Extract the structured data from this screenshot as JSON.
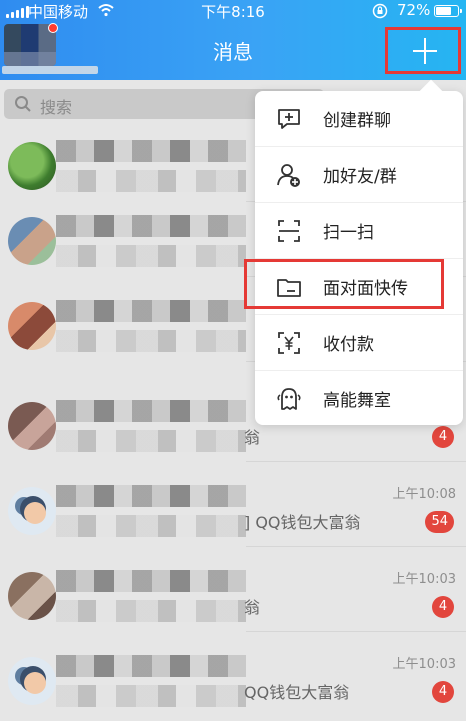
{
  "status_bar": {
    "carrier": "中国移动",
    "time": "下午8:16",
    "battery": "72%"
  },
  "header": {
    "title": "消息"
  },
  "search": {
    "placeholder": "搜索"
  },
  "menu": {
    "items": [
      {
        "label": "创建群聊",
        "icon": "group-chat-icon"
      },
      {
        "label": "加好友/群",
        "icon": "add-friend-icon"
      },
      {
        "label": "扫一扫",
        "icon": "scan-icon"
      },
      {
        "label": "面对面快传",
        "icon": "folder-icon"
      },
      {
        "label": "收付款",
        "icon": "payment-icon"
      },
      {
        "label": "高能舞室",
        "icon": "ghost-icon"
      }
    ]
  },
  "conversations": [
    {
      "time": "",
      "preview": "",
      "badge": ""
    },
    {
      "time": "",
      "preview": "",
      "badge": ""
    },
    {
      "time": "",
      "preview": "",
      "badge": ""
    },
    {
      "time": "",
      "preview": "翁",
      "badge": "4"
    },
    {
      "time": "上午10:08",
      "preview": "] QQ钱包大富翁",
      "badge": "54"
    },
    {
      "time": "上午10:03",
      "preview": "翁",
      "badge": "4"
    },
    {
      "time": "上午10:03",
      "preview": "QQ钱包大富翁",
      "badge": "4"
    }
  ],
  "colors": {
    "header_blue": "#3aa3f5",
    "badge_red": "#e2463d",
    "highlight_red": "#e53935"
  }
}
